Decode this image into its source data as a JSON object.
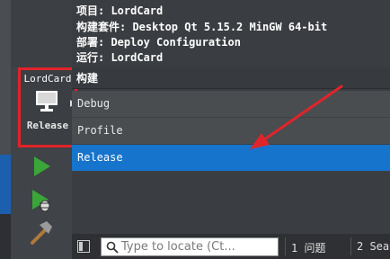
{
  "sidebar": {
    "target_selector": {
      "project": "LordCard",
      "build": "Release"
    }
  },
  "info_panel": {
    "lines": [
      "项目: LordCard",
      "构建套件: Desktop Qt 5.15.2 MinGW 64-bit",
      "部署: Deploy Configuration",
      "运行: LordCard"
    ]
  },
  "build_menu": {
    "title": "构建",
    "items": [
      "Debug",
      "Profile",
      "Release"
    ],
    "selected": "Release"
  },
  "statusbar": {
    "locator_placeholder": "Type to locate (Ct...",
    "tabs": [
      "1 问题",
      "2 Sear"
    ]
  },
  "colors": {
    "highlight": "#1674cc",
    "annotation": "#e0242a",
    "run_green": "#3aa63a"
  },
  "icons": [
    "monitor-icon",
    "expand-arrow-icon",
    "run-icon",
    "debug-run-icon",
    "hammer-icon",
    "sidebar-toggle-icon",
    "search-icon"
  ]
}
